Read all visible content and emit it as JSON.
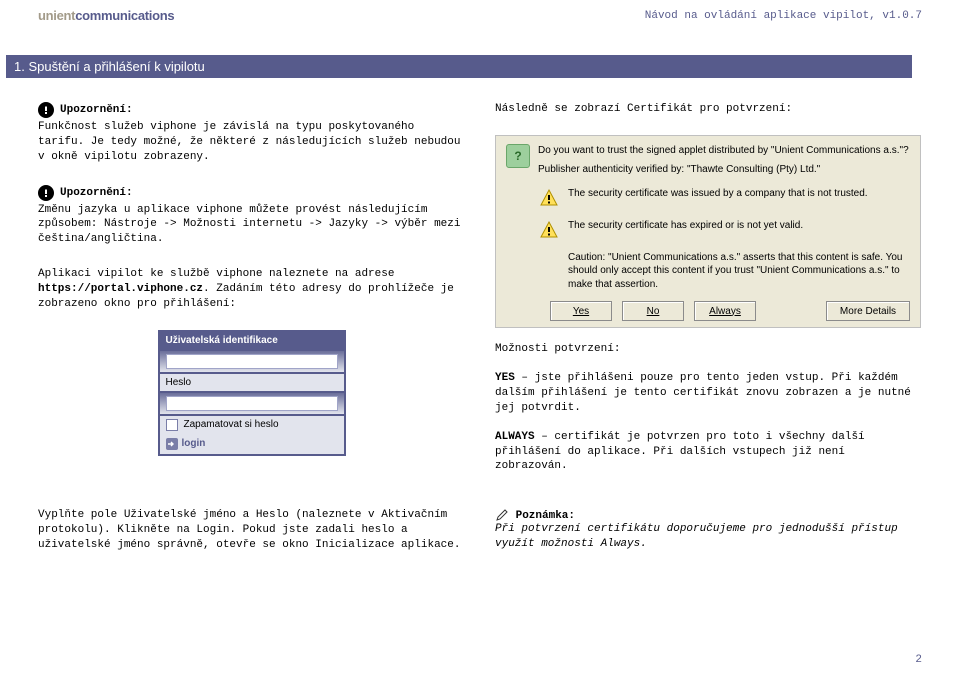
{
  "header": {
    "logo_p1": "unient",
    "logo_p2": "communications",
    "right": "Návod na ovládání aplikace vipilot, v1.0.7"
  },
  "section_title": "1.  Spuštění a přihlášení k vipilotu",
  "left": {
    "warn1_title": "Upozornění:",
    "warn1_text": "Funkčnost služeb viphone je závislá na typu poskytovaného tarifu. Je tedy možné, že některé z následujících služeb nebudou v okně vipilotu zobrazeny.",
    "warn2_title": "Upozornění:",
    "warn2_text": "Změnu jazyka u aplikace viphone můžete provést následujícím způsobem: Nástroje -> Možnosti internetu -> Jazyky -> výběr mezi čeština/angličtina.",
    "adr_p1": "Aplikaci vipilot ke službě viphone naleznete na adrese ",
    "adr_bold": "https://portal.viphone.cz",
    "adr_p2": ". Zadáním této adresy do prohlížeče je zobrazeno okno pro přihlášení:",
    "login": {
      "title": "Uživatelská identifikace",
      "pw": "Heslo",
      "remember": "Zapamatovat si heslo",
      "login": "login"
    },
    "bottom": "Vyplňte pole Uživatelské jméno a Heslo (naleznete v Aktivačním protokolu). Klikněte na  Login. Pokud jste zadali heslo a uživatelské jméno správně, otevře se okno Inicializace aplikace."
  },
  "right": {
    "intro": "Následně se zobrazí Certifikát pro potvrzení:",
    "cert": {
      "l1": "Do you want to trust the signed applet distributed by \"Unient Communications a.s.\"?",
      "l2": "Publisher authenticity verified by: \"Thawte Consulting (Pty) Ltd.\"",
      "l3": "The security certificate was issued by a company that is not trusted.",
      "l4": "The security certificate has expired or is not yet valid.",
      "l5": "Caution: \"Unient Communications a.s.\" asserts that this content is safe. You should only accept this content if you trust \"Unient Communications a.s.\" to make that assertion.",
      "btn_yes": "Yes",
      "btn_no": "No",
      "btn_always": "Always",
      "btn_more": "More Details"
    },
    "opts_title": "Možnosti potvrzení:",
    "yes_b": "YES",
    "yes_t": " – jste přihlášeni pouze pro tento jeden vstup. Při každém dalším přihlášení je tento certifikát znovu zobrazen a je nutné jej potvrdit.",
    "always_b": "ALWAYS",
    "always_t": " – certifikát je potvrzen pro toto i všechny další přihlášení do aplikace. Při dalších vstupech již není zobrazován.",
    "note_title": " Poznámka:",
    "note_text": "Při potvrzení certifikátu doporučujeme pro jednodušší přístup využít možnosti Always."
  },
  "page_num": "2"
}
